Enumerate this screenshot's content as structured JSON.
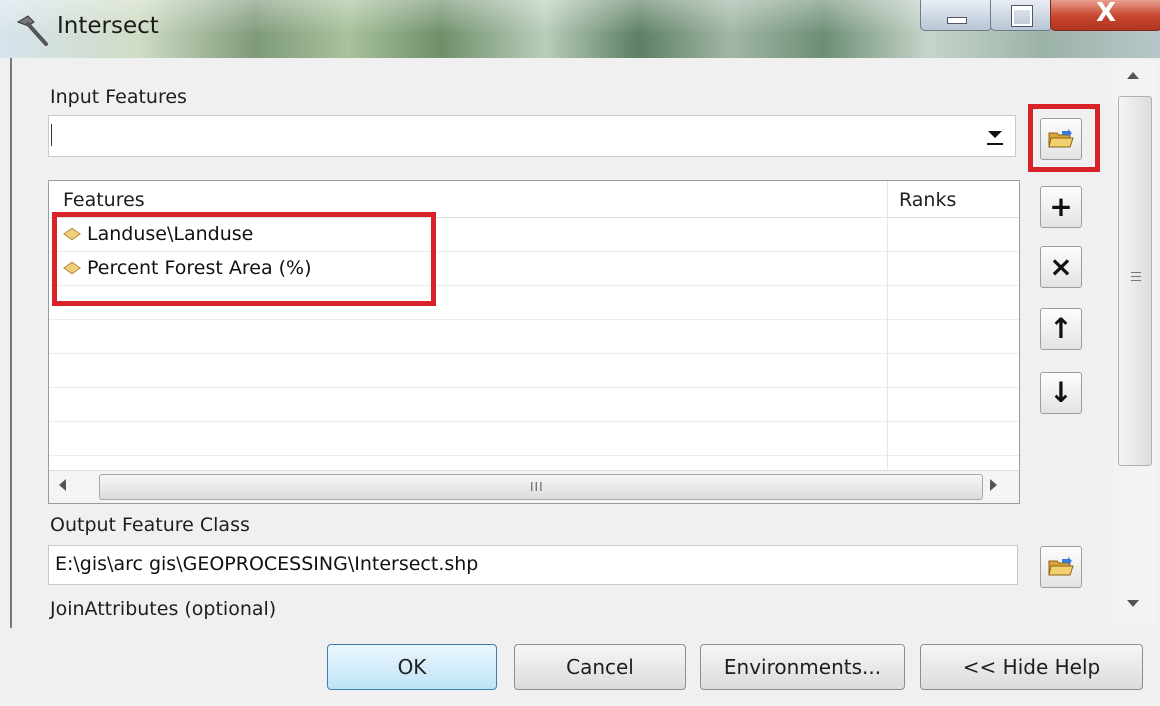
{
  "window": {
    "title": "Intersect",
    "controls": {
      "minimize": "minimize-icon",
      "maximize": "maximize-icon",
      "close": "close-icon",
      "close_glyph": "X"
    }
  },
  "input_features": {
    "label": "Input Features",
    "value": "",
    "browse_icon": "open-folder-icon"
  },
  "features_table": {
    "columns": [
      "Features",
      "Ranks"
    ],
    "rows": [
      {
        "name": "Landuse\\Landuse",
        "rank": "",
        "icon": "feature-layer-diamond-icon"
      },
      {
        "name": "Percent Forest Area (%)",
        "rank": "",
        "icon": "feature-layer-diamond-icon"
      }
    ],
    "side_buttons": [
      {
        "name": "add",
        "glyph": "+"
      },
      {
        "name": "remove",
        "glyph": "×"
      },
      {
        "name": "move-up",
        "glyph": "↑"
      },
      {
        "name": "move-down",
        "glyph": "↓"
      }
    ],
    "hscroll_grip": "III"
  },
  "output_feature_class": {
    "label": "Output Feature Class",
    "value": "E:\\gis\\arc gis\\GEOPROCESSING\\Intersect.shp"
  },
  "join_attributes": {
    "label": "JoinAttributes (optional)"
  },
  "footer": {
    "ok": "OK",
    "cancel": "Cancel",
    "environments": "Environments...",
    "hide_help": "<< Hide Help"
  },
  "colors": {
    "highlight": "#d8232a",
    "feature_icon": "#f0cf7a",
    "ok_button": "#bfe3f7"
  }
}
